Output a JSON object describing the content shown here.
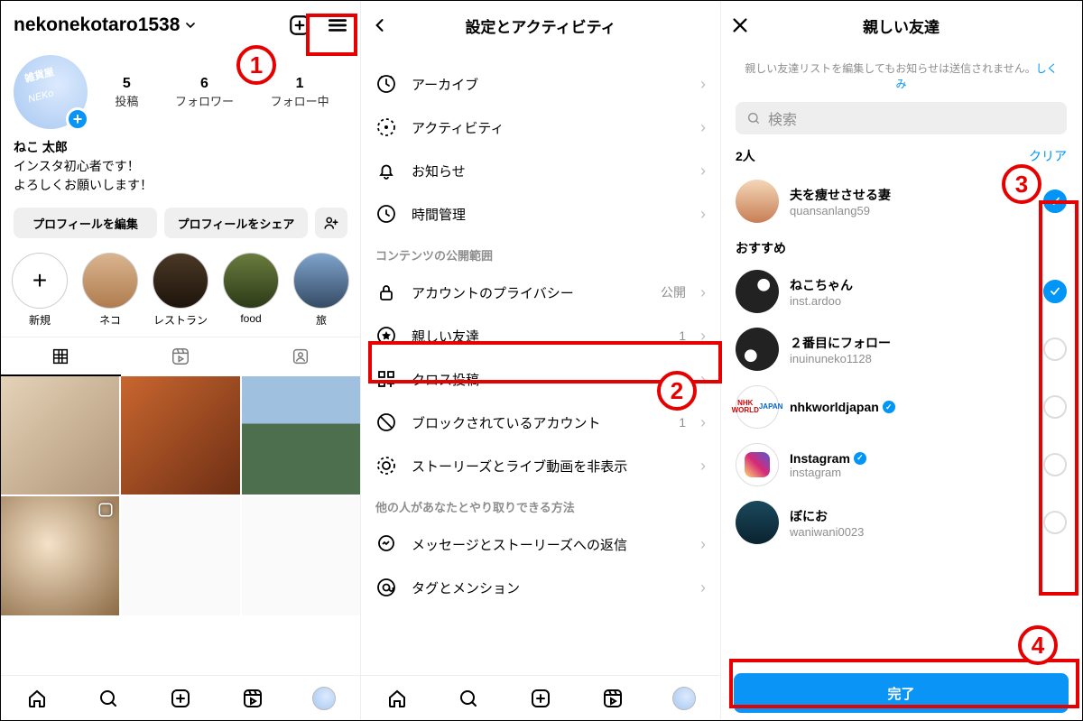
{
  "screen1": {
    "username": "nekonekotaro1538",
    "stats": {
      "posts": {
        "n": "5",
        "l": "投稿"
      },
      "followers": {
        "n": "6",
        "l": "フォロワー"
      },
      "following": {
        "n": "1",
        "l": "フォロー中"
      }
    },
    "bio": {
      "name": "ねこ 太郎",
      "line1": "インスタ初心者です！",
      "line2": "よろしくお願いします！"
    },
    "buttons": {
      "edit": "プロフィールを編集",
      "share": "プロフィールをシェア"
    },
    "stories": {
      "new": "新規",
      "s1": "ネコ",
      "s2": "レストラン",
      "s3": "food",
      "s4": "旅"
    }
  },
  "screen2": {
    "title": "設定とアクティビティ",
    "items": {
      "archive": "アーカイブ",
      "activity": "アクティビティ",
      "notifications": "お知らせ",
      "time": "時間管理"
    },
    "sec2_header": "コンテンツの公開範囲",
    "sec2_items": {
      "privacy": {
        "label": "アカウントのプライバシー",
        "meta": "公開"
      },
      "close_friends": {
        "label": "親しい友達",
        "meta": "1"
      },
      "cross_post": {
        "label": "クロス投稿"
      },
      "blocked": {
        "label": "ブロックされているアカウント",
        "meta": "1"
      },
      "hide": {
        "label": "ストーリーズとライブ動画を非表示"
      }
    },
    "sec3_header": "他の人があなたとやり取りできる方法",
    "sec3_items": {
      "replies": "メッセージとストーリーズへの返信",
      "tags": "タグとメンション"
    }
  },
  "screen3": {
    "title": "親しい友達",
    "note_text": "親しい友達リストを編集してもお知らせは送信されません。",
    "note_link": "しくみ",
    "search_placeholder": "検索",
    "count": "2人",
    "clear": "クリア",
    "users": {
      "u1": {
        "name": "夫を痩せさせる妻",
        "handle": "quansanlang59"
      },
      "suggest_header": "おすすめ",
      "u2": {
        "name": "ねこちゃん",
        "handle": "inst.ardoo"
      },
      "u3": {
        "name": "２番目にフォロー",
        "handle": "inuinuneko1128"
      },
      "u4": {
        "name": "nhkworldjapan",
        "handle": ""
      },
      "u5": {
        "name": "Instagram",
        "handle": "instagram"
      },
      "u6": {
        "name": "ぼにお",
        "handle": "waniwani0023"
      }
    },
    "done": "完了"
  }
}
